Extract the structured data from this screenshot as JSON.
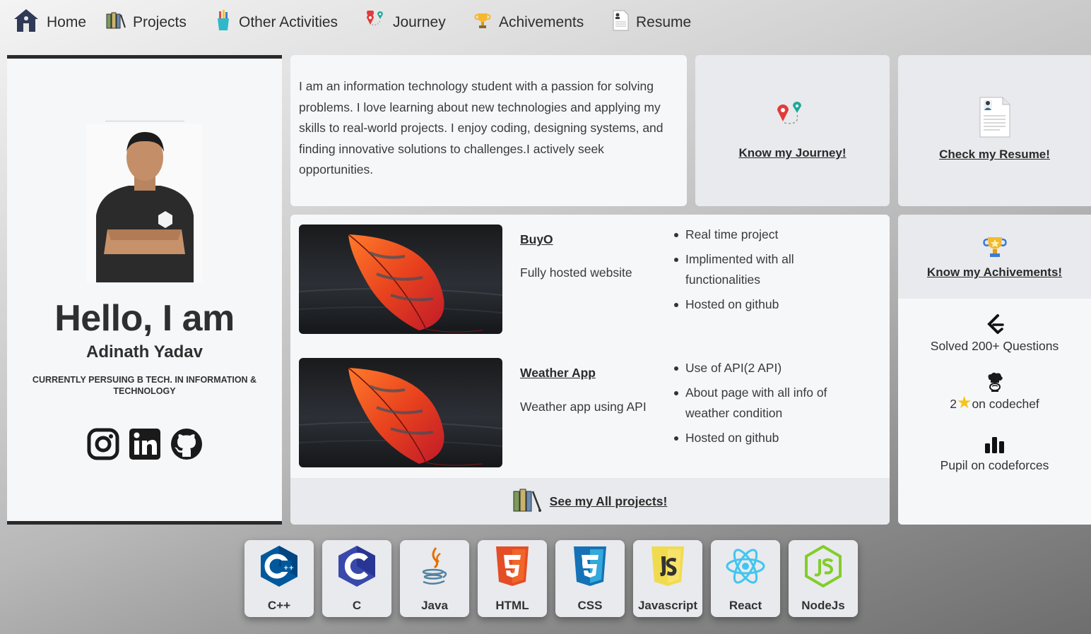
{
  "nav": {
    "items": [
      {
        "label": "Home",
        "icon": "home-icon"
      },
      {
        "label": "Projects",
        "icon": "folders-icon"
      },
      {
        "label": "Other Activities",
        "icon": "pen-holder-icon"
      },
      {
        "label": "Journey",
        "icon": "map-pins-icon"
      },
      {
        "label": "Achivements",
        "icon": "trophy-icon"
      },
      {
        "label": "Resume",
        "icon": "resume-icon"
      }
    ]
  },
  "profile": {
    "greeting": "Hello, I am",
    "name": "Adinath Yadav",
    "tagline": "CURRENTLY PERSUING B TECH. IN INFORMATION & TECHNOLOGY",
    "socials": [
      "instagram-icon",
      "linkedin-icon",
      "github-icon"
    ]
  },
  "about": {
    "text": "I am an information technology student with a passion for solving problems. I love learning about new technologies and applying my skills to real-world projects. I enjoy coding, designing systems, and finding innovative solutions to challenges.I actively seek opportunities."
  },
  "journey_card": {
    "label": "Know my Journey!"
  },
  "resume_card": {
    "label": "Check my Resume!"
  },
  "projects": {
    "items": [
      {
        "title": "BuyO",
        "description": "Fully hosted website",
        "points": [
          "Real time project",
          "Implimented with all functionalities",
          "Hosted on github"
        ]
      },
      {
        "title": "Weather App",
        "description": "Weather app using API",
        "points": [
          "Use of API(2 API)",
          "About page with all info of weather condition",
          "Hosted on github"
        ]
      }
    ],
    "see_all_label": "See my All projects!"
  },
  "achievements": {
    "header_label": "Know my Achivements!",
    "leetcode": "Solved 200+ Questions",
    "codechef_prefix": "2",
    "codechef_suffix": "on codechef",
    "codeforces": "Pupil on codeforces"
  },
  "skills": [
    {
      "label": "C++",
      "icon": "cpp-icon",
      "color": "#00599c"
    },
    {
      "label": "C",
      "icon": "c-icon",
      "color": "#283593"
    },
    {
      "label": "Java",
      "icon": "java-icon",
      "color": "#e76f00"
    },
    {
      "label": "HTML",
      "icon": "html5-icon",
      "color": "#e44d26"
    },
    {
      "label": "CSS",
      "icon": "css3-icon",
      "color": "#1572b6"
    },
    {
      "label": "Javascript",
      "icon": "javascript-icon",
      "color": "#f0db4f"
    },
    {
      "label": "React",
      "icon": "react-icon",
      "color": "#61dafb"
    },
    {
      "label": "NodeJs",
      "icon": "nodejs-icon",
      "color": "#83cd29"
    }
  ]
}
